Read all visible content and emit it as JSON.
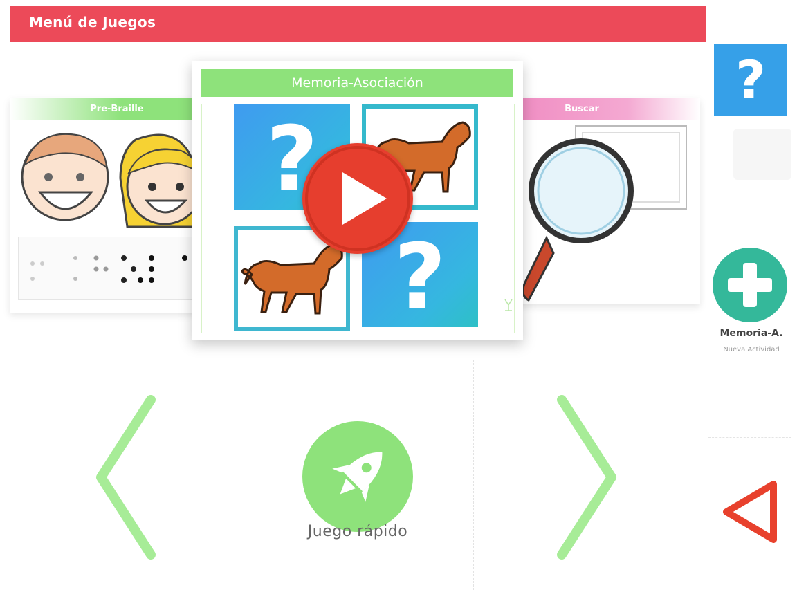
{
  "header": {
    "title": "Menú de Juegos"
  },
  "carousel": {
    "left_card": {
      "title": "Pre-Braille"
    },
    "featured": {
      "title": "Memoria-Asociación",
      "tile_symbol": "?"
    },
    "right_card": {
      "title": "Buscar"
    }
  },
  "bottom_nav": {
    "quick_game_label": "Juego rápido"
  },
  "right_panel": {
    "help_symbol": "?",
    "new_activity": {
      "name": "Memoria-A.",
      "subtitle": "Nueva Actividad"
    }
  },
  "colors": {
    "header": "#ec4a59",
    "green": "#8ee27b",
    "blue": "#36a0e8",
    "teal": "#34b89a",
    "red": "#e63e2e",
    "pink": "#f08ec3"
  },
  "icons": [
    "play-icon",
    "rocket-icon",
    "plus-icon",
    "question-icon",
    "back-triangle-icon",
    "chevron-left-icon",
    "chevron-right-icon",
    "magnifier-icon",
    "dog-icon"
  ]
}
